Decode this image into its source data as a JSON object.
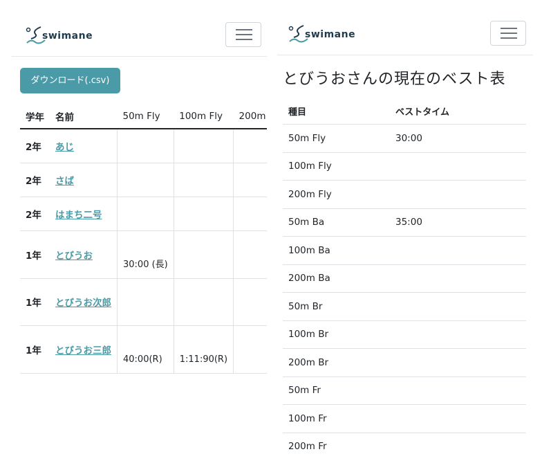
{
  "brand": {
    "name": "swimane"
  },
  "left": {
    "download_button": "ダウンロード(.csv)",
    "columns": [
      "学年",
      "名前",
      "50m Fly",
      "100m Fly",
      "200m"
    ],
    "rows": [
      {
        "grade": "2年",
        "name": "あじ",
        "fly50": "",
        "fly100": "",
        "fly200": ""
      },
      {
        "grade": "2年",
        "name": "さば",
        "fly50": "",
        "fly100": "",
        "fly200": ""
      },
      {
        "grade": "2年",
        "name": "はまち二号",
        "fly50": "",
        "fly100": "",
        "fly200": ""
      },
      {
        "grade": "1年",
        "name": "とびうお",
        "fly50": "30:00 (長)",
        "fly100": "",
        "fly200": ""
      },
      {
        "grade": "1年",
        "name": "とびうお次郎",
        "fly50": "",
        "fly100": "",
        "fly200": ""
      },
      {
        "grade": "1年",
        "name": "とびうお三郎",
        "fly50": "40:00(R)",
        "fly100": "1:11:90(R)",
        "fly200": ""
      }
    ]
  },
  "right": {
    "title": "とびうおさんの現在のベスト表",
    "columns": [
      "種目",
      "ベストタイム"
    ],
    "rows": [
      {
        "event": "50m Fly",
        "time": "30:00"
      },
      {
        "event": "100m Fly",
        "time": ""
      },
      {
        "event": "200m Fly",
        "time": ""
      },
      {
        "event": "50m Ba",
        "time": "35:00"
      },
      {
        "event": "100m Ba",
        "time": ""
      },
      {
        "event": "200m Ba",
        "time": ""
      },
      {
        "event": "50m Br",
        "time": ""
      },
      {
        "event": "100m Br",
        "time": ""
      },
      {
        "event": "200m Br",
        "time": ""
      },
      {
        "event": "50m Fr",
        "time": ""
      },
      {
        "event": "100m Fr",
        "time": ""
      },
      {
        "event": "200m Fr",
        "time": ""
      }
    ]
  },
  "icons": {
    "menu": "hamburger-menu-icon",
    "logo": "swimane-logo-wave-icon"
  },
  "colors": {
    "accent": "#4a9ba7",
    "brand_text": "#1f3b4d"
  }
}
